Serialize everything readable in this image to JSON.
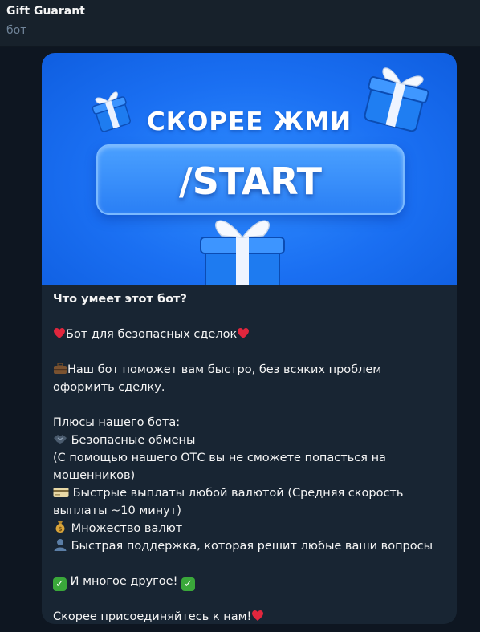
{
  "header": {
    "title": "Gift Guarant",
    "subtitle": "бот"
  },
  "banner": {
    "headline": "СКОРЕЕ ЖМИ",
    "button_label": "/START"
  },
  "message": {
    "intro_title": "Что умеет этот бот?",
    "tagline": "Бот для безопасных сделок",
    "description_line1": "Наш бот поможет вам быстро, без всяких проблем",
    "description_line2": "оформить сделку.",
    "pluses_title": "Плюсы нашего бота:",
    "features": [
      {
        "icon": "handshake-icon",
        "text": "Безопасные обмены"
      },
      {
        "icon": "",
        "text": "(С помощью нашего ОТС вы не сможете попасться на"
      },
      {
        "icon": "",
        "text": "мошенников)"
      },
      {
        "icon": "credit-card-icon",
        "text": "Быстрые выплаты любой валютой (Средняя скорость"
      },
      {
        "icon": "",
        "text": "выплаты ~10 минут)"
      },
      {
        "icon": "money-bag-icon",
        "text": "Множество валют"
      },
      {
        "icon": "user-icon",
        "text": "Быстрая поддержка, которая решит любые ваши вопросы"
      }
    ],
    "more_text": "И многое другое!",
    "cta": "Скорее присоединяйтесь к нам!"
  },
  "colors": {
    "background": "#0e1621",
    "header_bg": "#17212b",
    "bubble_bg": "#182533",
    "banner_blue": "#1a6ff2",
    "heart": "#e0263d",
    "check": "#3aa83a"
  }
}
